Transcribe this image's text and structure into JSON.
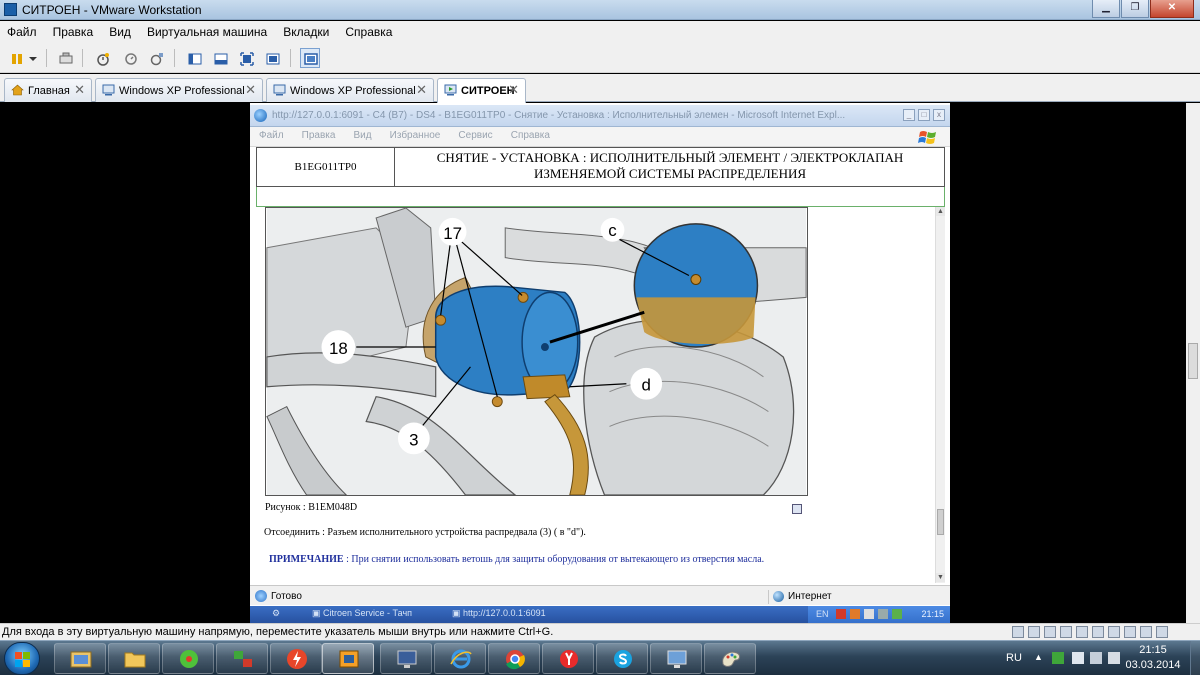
{
  "vmware": {
    "title": "СИТРОЕН - VMware Workstation",
    "menu": [
      "Файл",
      "Правка",
      "Вид",
      "Виртуальная машина",
      "Вкладки",
      "Справка"
    ],
    "tabs": [
      {
        "label": "Главная",
        "close": "✕"
      },
      {
        "label": "Windows XP Professional",
        "close": "✕"
      },
      {
        "label": "Windows XP Professional",
        "close": "✕"
      },
      {
        "label": "СИТРОЕН",
        "close": "✕"
      }
    ],
    "status_message": "Для входа в эту виртуальную машину напрямую, переместите указатель мыши внутрь или нажмите Ctrl+G."
  },
  "ie": {
    "title": "http://127.0.0.1:6091 - C4 (B7) - DS4 - B1EG011TP0 - Снятие - Установка : Исполнительный элемен - Microsoft Internet Expl...",
    "menu": [
      "Файл",
      "Правка",
      "Вид",
      "Избранное",
      "Сервис",
      "Справка"
    ],
    "status_ready": "Готово",
    "status_zone": "Интернет"
  },
  "document": {
    "code": "B1EG011TP0",
    "title_line1": "СНЯТИЕ - УСТАНОВКА : ИСПОЛНИТЕЛЬНЫЙ ЭЛЕМЕНТ / ЭЛЕКТРОКЛАПАН",
    "title_line2": "ИЗМЕНЯЕМОЙ СИСТЕМЫ РАСПРЕДЕЛЕНИЯ",
    "figure_labels": {
      "l17": "17",
      "lc": "c",
      "l18": "18",
      "ld": "d",
      "l3": "3"
    },
    "caption": "Рисунок : B1EM048D",
    "disconnect_text": "Отсоединить : Разъем исполнительного устройства распредвала (3) ( в \"d\").",
    "note_label": "ПРИМЕЧАНИЕ",
    "note_text": " : При снятии использовать ветошь для защиты оборудования от вытекающего из отверстия масла."
  },
  "guest_taskbar": {
    "item1": "Citroen Service - Тачп",
    "item2": "http://127.0.0.1:6091",
    "lang": "EN",
    "clock": "21:15"
  },
  "win7": {
    "lang": "RU",
    "time": "21:15",
    "date": "03.03.2014"
  },
  "colors": {
    "accent": "#2a6fc0",
    "note_blue": "#1f2f9c",
    "header_green": "#6ab06a"
  }
}
